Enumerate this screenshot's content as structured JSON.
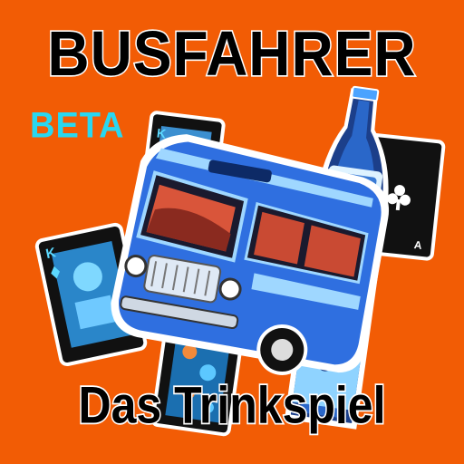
{
  "app": {
    "title": "BUSFAHRER",
    "badge": "BETA",
    "subtitle": "Das Trinkspiel"
  },
  "colors": {
    "background": "#f25c05",
    "badge": "#29d7f0",
    "bus_body": "#2f6fe0",
    "bus_trim": "#9fd7ff",
    "card_dark": "#111111",
    "bottle": "#2a67c9"
  },
  "icons": {
    "card_left": "playing-card-king-icon",
    "card_top": "playing-card-king-icon",
    "card_right": "playing-card-clubs-icon",
    "card_bottom": "playing-card-pattern-icon",
    "bottle": "beer-bottle-icon",
    "bus": "bus-icon"
  }
}
